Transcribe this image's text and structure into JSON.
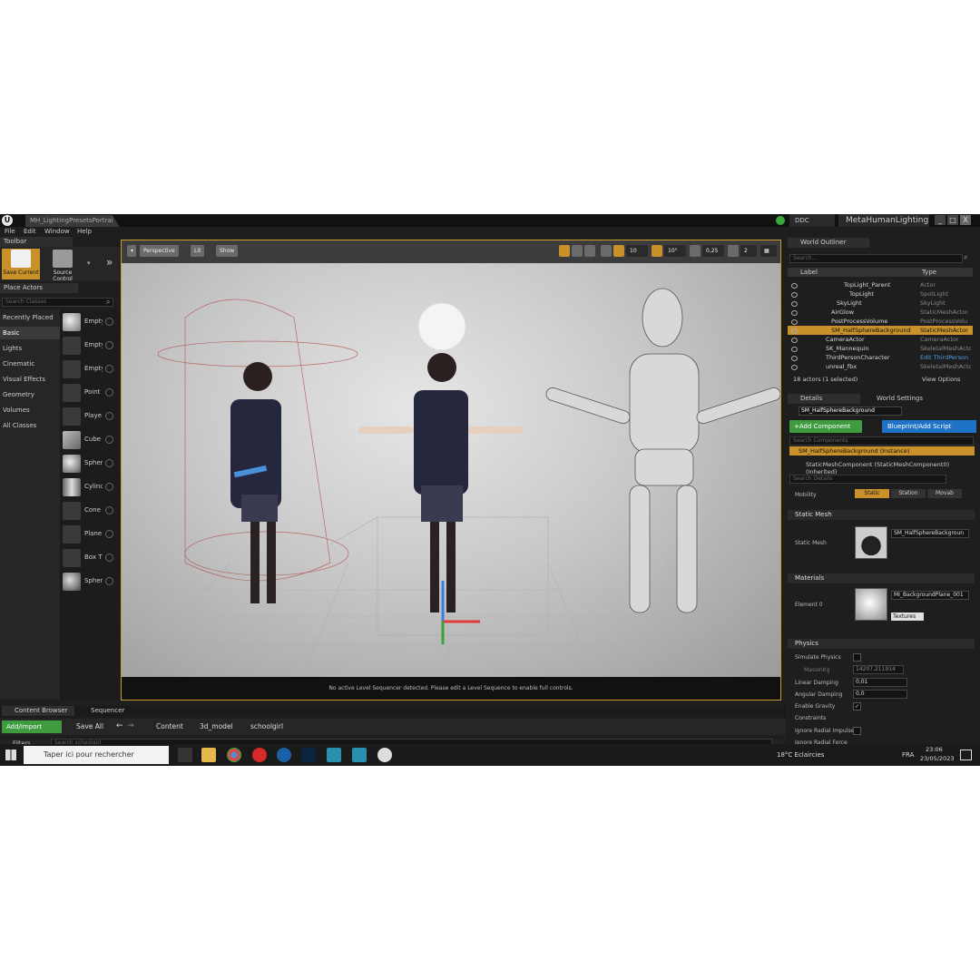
{
  "title_bar": {
    "doc_tab": "MH_LightingPresetsPortrai",
    "ddc": "DDC",
    "project_name": "MetaHumanLighting",
    "controls": [
      "_",
      "□",
      "X"
    ]
  },
  "menu": [
    "File",
    "Edit",
    "Window",
    "Help"
  ],
  "toolbar": {
    "tab": "Toolbar",
    "save_current": "Save Current",
    "source_control": "Source Control"
  },
  "place_actors": {
    "tab": "Place Actors",
    "search_placeholder": "Search Classes",
    "categories": [
      "Recently Placed",
      "Basic",
      "Lights",
      "Cinematic",
      "Visual Effects",
      "Geometry",
      "Volumes",
      "All Classes"
    ],
    "active_category": "Basic",
    "items": [
      "Empty",
      "Empty",
      "Empty",
      "Point",
      "Playe",
      "Cube",
      "Spher",
      "Cylinc",
      "Cone",
      "Plane",
      "Box T",
      "Spher"
    ]
  },
  "viewport": {
    "perspective": "Perspective",
    "lit": "Lit",
    "show": "Show",
    "grid_snap": "10",
    "rot_snap": "10°",
    "scale_snap": "0,25",
    "camera_speed": "2",
    "status_message": "No active Level Sequencer detected. Please edit a Level Sequence to enable full controls."
  },
  "world_outliner": {
    "tab": "World Outliner",
    "search_placeholder": "Search...",
    "col_label": "Label",
    "col_type": "Type",
    "rows": [
      {
        "name": "TopLight_Parent",
        "type": "Actor"
      },
      {
        "name": "TopLight",
        "type": "SpotLight"
      },
      {
        "name": "SkyLight",
        "type": "SkyLight"
      },
      {
        "name": "AirGlow",
        "type": "StaticMeshActor"
      },
      {
        "name": "PostProcessVolume",
        "type": "PostProcessVolu"
      },
      {
        "name": "SM_HalfSphereBackground",
        "type": "StaticMeshActor"
      },
      {
        "name": "CameraActor",
        "type": "CameraActor"
      },
      {
        "name": "SK_Mannequin",
        "type": "SkeletalMeshActor"
      },
      {
        "name": "ThirdPersonCharacter",
        "type": "Edit ThirdPerson"
      },
      {
        "name": "unreal_fbx",
        "type": "SkeletalMeshActor"
      }
    ],
    "footer": "18 actors (1 selected)",
    "view_options": "View Options"
  },
  "details": {
    "tab_details": "Details",
    "tab_world_settings": "World Settings",
    "object_name": "SM_HalfSphereBackground",
    "add_component": "+Add Component",
    "blueprint_script": "Blueprint/Add Script",
    "search_components": "Search Components",
    "instance_row": "SM_HalfSphereBackground (Instance)",
    "component_row": "StaticMeshComponent (StaticMeshComponent0) (Inherited)",
    "search_details": "Search Details",
    "mobility_label": "Mobility",
    "mobility_options": [
      "Static",
      "Station",
      "Movab"
    ],
    "static_mesh_section": "Static Mesh",
    "static_mesh_label": "Static Mesh",
    "static_mesh_value": "SM_HalfSphereBackgroun",
    "materials_section": "Materials",
    "element0_label": "Element 0",
    "element0_value": "MI_BackgroundPlane_001",
    "textures": "Textures",
    "physics_section": "Physics",
    "simulate_physics": "Simulate Physics",
    "mass_label": "MassInKg",
    "mass_value": "14207,211914",
    "linear_damping": "Linear Damping",
    "linear_damping_value": "0,01",
    "angular_damping": "Angular Damping",
    "angular_damping_value": "0,0",
    "enable_gravity": "Enable Gravity",
    "constraints": "Constraints",
    "ignore_radial_impulse": "Ignore Radial Impulse",
    "ignore_radial_force": "Ignore Radial Force"
  },
  "content_browser": {
    "tab": "Content Browser",
    "tab2": "Sequencer",
    "add_import": "Add/Import",
    "save_all": "Save All",
    "path": [
      "Content",
      "3d_model",
      "schoolgirl"
    ],
    "filters": "Filters",
    "search_placeholder": "Search schoolgirl"
  },
  "taskbar": {
    "search_placeholder": "Taper ici pour rechercher",
    "weather": "18°C  Eclaircies",
    "lang": "FRA",
    "time": "23:06",
    "date": "23/05/2023"
  },
  "colors": {
    "accent": "#c8912a",
    "add_green": "#3e9b3e",
    "blueprint_blue": "#1f73c6"
  }
}
